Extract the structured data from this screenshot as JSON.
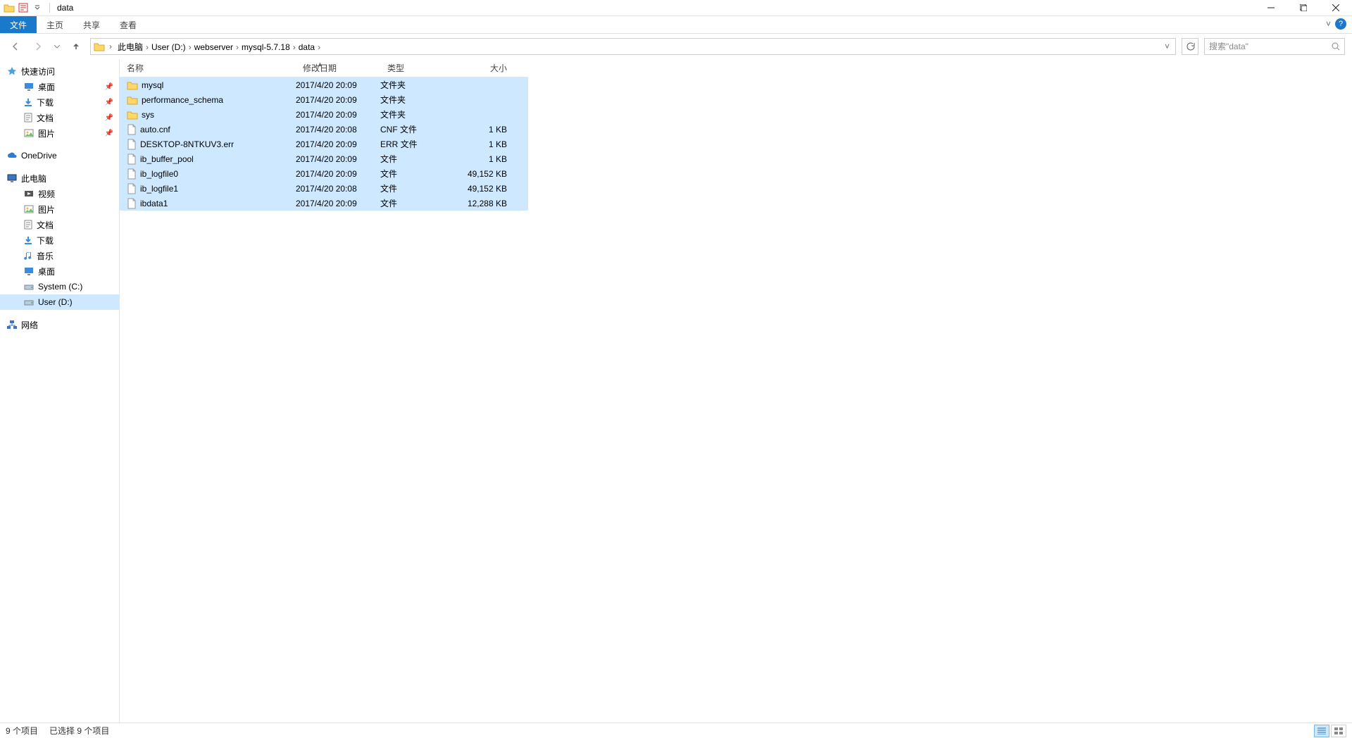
{
  "title": "data",
  "ribbon": {
    "tabs": [
      "文件",
      "主页",
      "共享",
      "查看"
    ],
    "active": 0
  },
  "breadcrumbs": [
    "此电脑",
    "User (D:)",
    "webserver",
    "mysql-5.7.18",
    "data"
  ],
  "search_placeholder": "搜索\"data\"",
  "sidebar": {
    "quick_access": {
      "label": "快速访问",
      "items": [
        {
          "label": "桌面",
          "icon": "desktop"
        },
        {
          "label": "下载",
          "icon": "download"
        },
        {
          "label": "文档",
          "icon": "doc"
        },
        {
          "label": "图片",
          "icon": "pic"
        }
      ]
    },
    "onedrive": {
      "label": "OneDrive"
    },
    "thispc": {
      "label": "此电脑",
      "items": [
        {
          "label": "视频",
          "icon": "video"
        },
        {
          "label": "图片",
          "icon": "pic"
        },
        {
          "label": "文档",
          "icon": "doc"
        },
        {
          "label": "下载",
          "icon": "download"
        },
        {
          "label": "音乐",
          "icon": "music"
        },
        {
          "label": "桌面",
          "icon": "desktop"
        },
        {
          "label": "System (C:)",
          "icon": "drive"
        },
        {
          "label": "User (D:)",
          "icon": "drive",
          "selected": true
        }
      ]
    },
    "network": {
      "label": "网络"
    }
  },
  "columns": {
    "name": "名称",
    "modified": "修改日期",
    "type": "类型",
    "size": "大小"
  },
  "files": [
    {
      "name": "mysql",
      "modified": "2017/4/20 20:09",
      "type": "文件夹",
      "size": "",
      "kind": "folder"
    },
    {
      "name": "performance_schema",
      "modified": "2017/4/20 20:09",
      "type": "文件夹",
      "size": "",
      "kind": "folder"
    },
    {
      "name": "sys",
      "modified": "2017/4/20 20:09",
      "type": "文件夹",
      "size": "",
      "kind": "folder"
    },
    {
      "name": "auto.cnf",
      "modified": "2017/4/20 20:08",
      "type": "CNF 文件",
      "size": "1 KB",
      "kind": "file"
    },
    {
      "name": "DESKTOP-8NTKUV3.err",
      "modified": "2017/4/20 20:09",
      "type": "ERR 文件",
      "size": "1 KB",
      "kind": "file"
    },
    {
      "name": "ib_buffer_pool",
      "modified": "2017/4/20 20:09",
      "type": "文件",
      "size": "1 KB",
      "kind": "file"
    },
    {
      "name": "ib_logfile0",
      "modified": "2017/4/20 20:09",
      "type": "文件",
      "size": "49,152 KB",
      "kind": "file"
    },
    {
      "name": "ib_logfile1",
      "modified": "2017/4/20 20:08",
      "type": "文件",
      "size": "49,152 KB",
      "kind": "file"
    },
    {
      "name": "ibdata1",
      "modified": "2017/4/20 20:09",
      "type": "文件",
      "size": "12,288 KB",
      "kind": "file"
    }
  ],
  "status": {
    "count": "9 个项目",
    "selected": "已选择 9 个项目"
  }
}
